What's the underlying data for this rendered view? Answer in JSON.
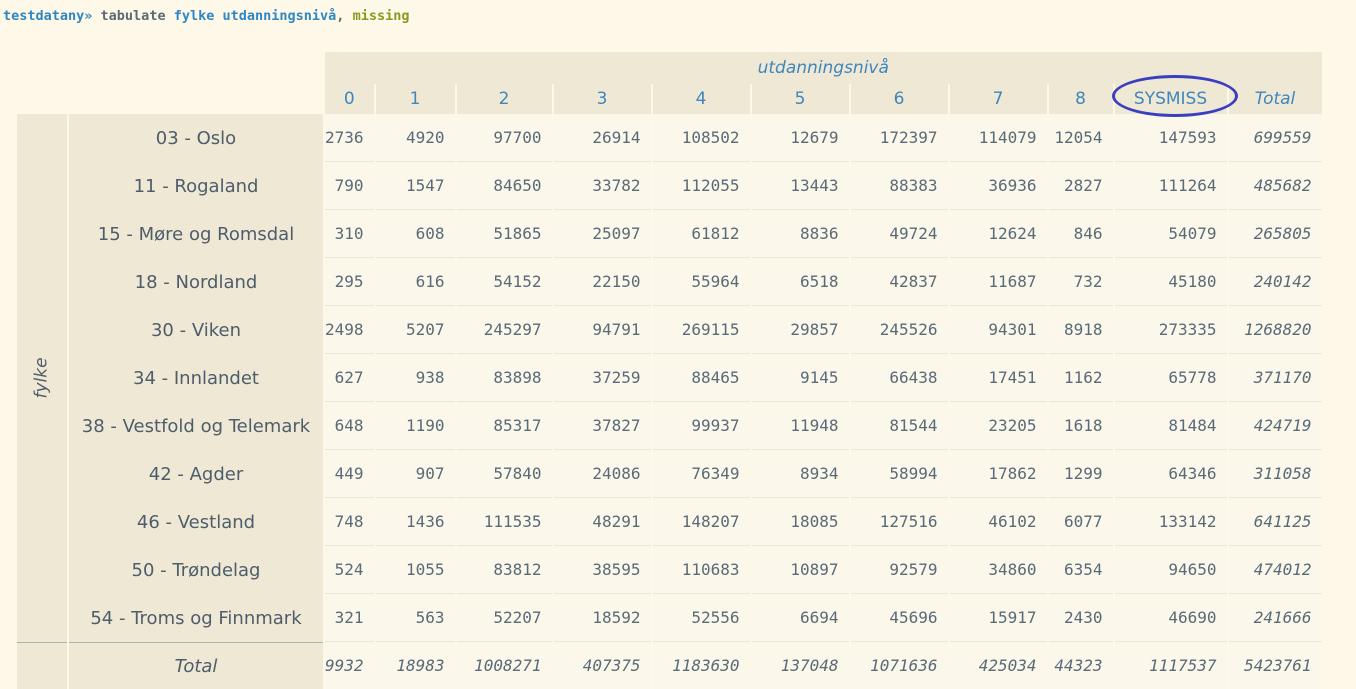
{
  "command": {
    "prompt": "testdatany»",
    "keyword": "tabulate",
    "var1": "fylke",
    "var2": "utdanningsnivå",
    "comma": ",",
    "option": "missing"
  },
  "table": {
    "col_var": "utdanningsnivå",
    "row_var": "fylke",
    "columns": [
      "0",
      "1",
      "2",
      "3",
      "4",
      "5",
      "6",
      "7",
      "8",
      "SYSMISS",
      "Total"
    ],
    "highlighted_column": "SYSMISS",
    "rows": [
      {
        "label": "03 - Oslo",
        "values": [
          "2736",
          "4920",
          "97700",
          "26914",
          "108502",
          "12679",
          "172397",
          "114079",
          "12054",
          "147593",
          "699559"
        ]
      },
      {
        "label": "11 - Rogaland",
        "values": [
          "790",
          "1547",
          "84650",
          "33782",
          "112055",
          "13443",
          "88383",
          "36936",
          "2827",
          "111264",
          "485682"
        ]
      },
      {
        "label": "15 - Møre og Romsdal",
        "values": [
          "310",
          "608",
          "51865",
          "25097",
          "61812",
          "8836",
          "49724",
          "12624",
          "846",
          "54079",
          "265805"
        ]
      },
      {
        "label": "18 - Nordland",
        "values": [
          "295",
          "616",
          "54152",
          "22150",
          "55964",
          "6518",
          "42837",
          "11687",
          "732",
          "45180",
          "240142"
        ]
      },
      {
        "label": "30 - Viken",
        "values": [
          "2498",
          "5207",
          "245297",
          "94791",
          "269115",
          "29857",
          "245526",
          "94301",
          "8918",
          "273335",
          "1268820"
        ]
      },
      {
        "label": "34 - Innlandet",
        "values": [
          "627",
          "938",
          "83898",
          "37259",
          "88465",
          "9145",
          "66438",
          "17451",
          "1162",
          "65778",
          "371170"
        ]
      },
      {
        "label": "38 - Vestfold og Telemark",
        "values": [
          "648",
          "1190",
          "85317",
          "37827",
          "99937",
          "11948",
          "81544",
          "23205",
          "1618",
          "81484",
          "424719"
        ]
      },
      {
        "label": "42 - Agder",
        "values": [
          "449",
          "907",
          "57840",
          "24086",
          "76349",
          "8934",
          "58994",
          "17862",
          "1299",
          "64346",
          "311058"
        ]
      },
      {
        "label": "46 - Vestland",
        "values": [
          "748",
          "1436",
          "111535",
          "48291",
          "148207",
          "18085",
          "127516",
          "46102",
          "6077",
          "133142",
          "641125"
        ]
      },
      {
        "label": "50 - Trøndelag",
        "values": [
          "524",
          "1055",
          "83812",
          "38595",
          "110683",
          "10897",
          "92579",
          "34860",
          "6354",
          "94650",
          "474012"
        ]
      },
      {
        "label": "54 - Troms og Finnmark",
        "values": [
          "321",
          "563",
          "52207",
          "18592",
          "52556",
          "6694",
          "45696",
          "15917",
          "2430",
          "46690",
          "241666"
        ]
      }
    ],
    "total_row": {
      "label": "Total",
      "values": [
        "9932",
        "18983",
        "1008271",
        "407375",
        "1183630",
        "137048",
        "1071636",
        "425034",
        "44323",
        "1117537",
        "5423761"
      ]
    }
  },
  "colors": {
    "highlight_circle": "#3a3fc0",
    "header_text": "#3e86bd",
    "header_bg": "#efe8d4",
    "page_bg": "#fdf8e8"
  }
}
